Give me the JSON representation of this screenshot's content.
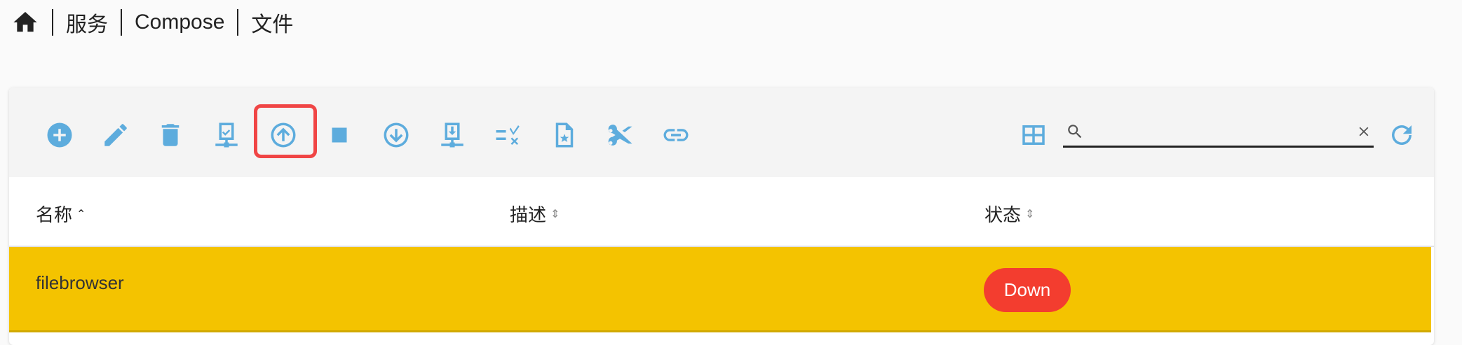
{
  "breadcrumb": {
    "items": [
      "服务",
      "Compose",
      "文件"
    ]
  },
  "toolbar": {
    "buttons": [
      "add-icon",
      "edit-icon",
      "delete-icon",
      "deploy-icon",
      "start-icon",
      "stop-icon",
      "pull-icon",
      "download-icon",
      "clean-icon",
      "file-star-icon",
      "cut-icon",
      "link-icon"
    ],
    "highlighted": "start-icon",
    "highlight_color": "#f04545",
    "icon_color": "#5dacdd"
  },
  "search": {
    "value": "",
    "placeholder": ""
  },
  "table": {
    "columns": [
      {
        "label": "名称",
        "sort": "asc"
      },
      {
        "label": "描述",
        "sort": "none"
      },
      {
        "label": "状态",
        "sort": "none"
      }
    ],
    "rows": [
      {
        "name": "filebrowser",
        "description": "",
        "status": "Down",
        "highlight_color": "#f4c300",
        "status_color": "#f33d2f"
      }
    ]
  }
}
